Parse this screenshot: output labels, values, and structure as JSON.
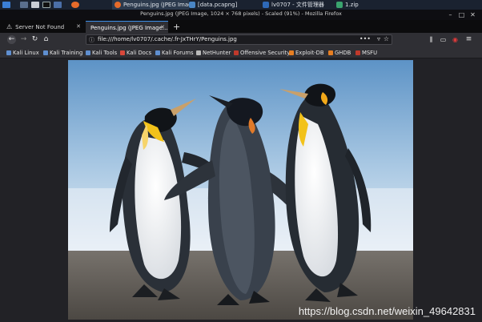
{
  "taskbar": {
    "tasks": [
      {
        "label": "Penguins.jpg (JPEG Imag...",
        "icon": "firefox-icon",
        "active": true
      },
      {
        "label": "[data.pcapng]",
        "icon": "wireshark-icon",
        "active": false
      },
      {
        "label": "lv0707 - 文件管理器",
        "icon": "folder-icon",
        "active": false
      },
      {
        "label": "1.zip",
        "icon": "archive-icon",
        "active": false
      }
    ]
  },
  "window": {
    "title": "Penguins.jpg (JPEG Image, 1024 × 768 pixels) - Scaled (91%) - Mozilla Firefox"
  },
  "tabs": [
    {
      "label": "Server Not Found",
      "active": false
    },
    {
      "label": "Penguins.jpg (JPEG Image...",
      "active": true
    }
  ],
  "nav": {
    "url": "file:///home/lv0707/.cache/.fr-JxTHrY/Penguins.jpg"
  },
  "bookmarks": [
    "Kali Linux",
    "Kali Training",
    "Kali Tools",
    "Kali Docs",
    "Kali Forums",
    "NetHunter",
    "Offensive Security",
    "Exploit-DB",
    "GHDB",
    "MSFU"
  ],
  "watermark": "https://blog.csdn.net/weixin_49642831",
  "colors": {
    "accent": "#3b8eea",
    "sky_top": "#5d93c6",
    "sky_bottom": "#d7e6f2",
    "ground": "#5e5a55"
  }
}
